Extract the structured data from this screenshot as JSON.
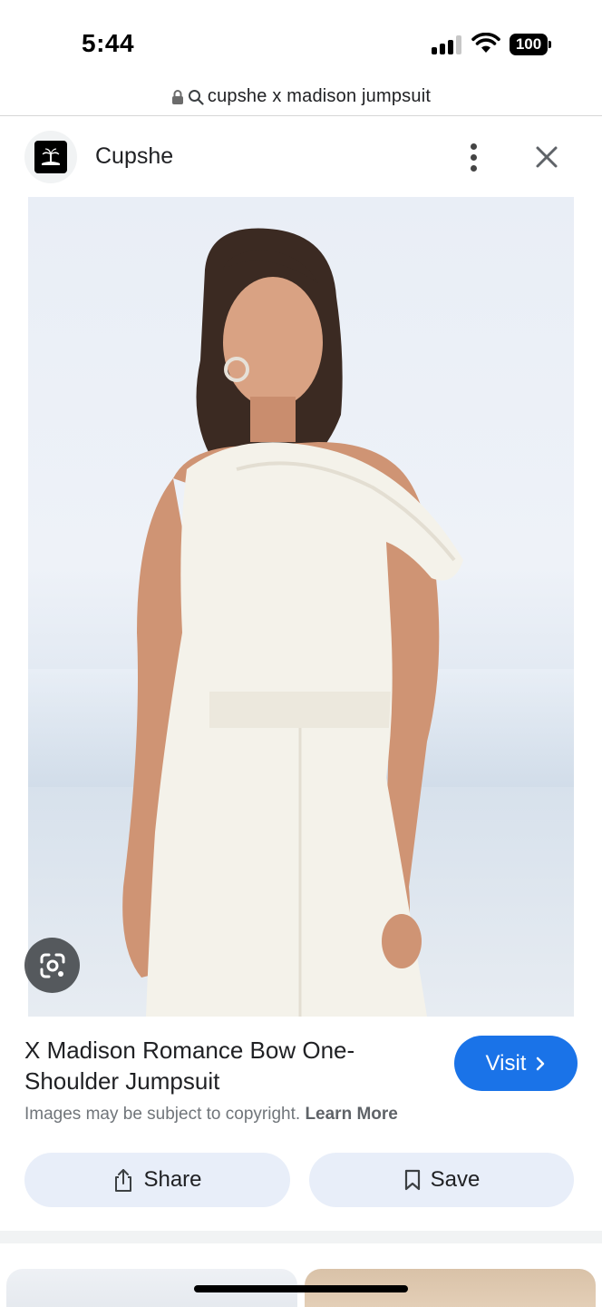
{
  "status_bar": {
    "time": "5:44",
    "battery": "100",
    "icons": [
      "cellular-signal-icon",
      "wifi-icon",
      "battery-icon"
    ]
  },
  "url_bar": {
    "query": "cupshe x madison jumpsuit",
    "icons": [
      "lock-icon",
      "search-icon"
    ]
  },
  "header": {
    "site_name": "Cupshe",
    "icons": [
      "site-logo-icon",
      "more-vert-icon",
      "close-icon"
    ]
  },
  "image": {
    "icons": [
      "lens-icon"
    ]
  },
  "result": {
    "title": "X Madison Romance Bow One-Shoulder Jumpsuit",
    "visit_label": "Visit",
    "copyright_text": "Images may be subject to copyright.",
    "learn_more": "Learn More",
    "share_label": "Share",
    "save_label": "Save"
  },
  "colors": {
    "accent": "#1a73e8",
    "pill_background": "#e8eef9",
    "text_primary": "#202124",
    "text_secondary": "#70757a"
  }
}
